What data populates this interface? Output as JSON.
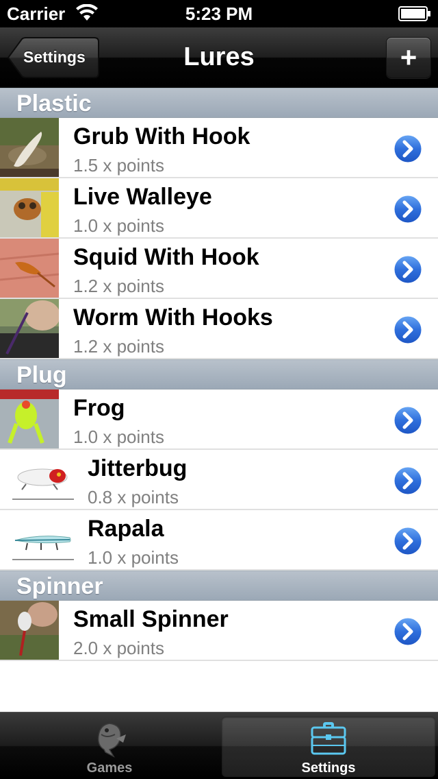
{
  "status_bar": {
    "carrier": "Carrier",
    "time": "5:23 PM"
  },
  "nav_bar": {
    "back_label": "Settings",
    "title": "Lures",
    "add_label": "+"
  },
  "sections": [
    {
      "title": "Plastic",
      "items": [
        {
          "name": "Grub With Hook",
          "points": "1.5 x points"
        },
        {
          "name": "Live Walleye",
          "points": "1.0 x points"
        },
        {
          "name": "Squid With Hook",
          "points": "1.2 x points"
        },
        {
          "name": "Worm With Hooks",
          "points": "1.2 x points"
        }
      ]
    },
    {
      "title": "Plug",
      "items": [
        {
          "name": "Frog",
          "points": "1.0 x points"
        },
        {
          "name": "Jitterbug",
          "points": "0.8 x points"
        },
        {
          "name": "Rapala",
          "points": "1.0 x points"
        }
      ]
    },
    {
      "title": "Spinner",
      "items": [
        {
          "name": "Small Spinner",
          "points": "2.0 x points"
        }
      ]
    }
  ],
  "tab_bar": {
    "tabs": [
      {
        "label": "Games",
        "icon": "fish-icon",
        "selected": false
      },
      {
        "label": "Settings",
        "icon": "tackle-box-icon",
        "selected": true
      }
    ]
  },
  "colors": {
    "disclosure_blue": "#2f6fdc",
    "section_header": "#a8b3bf",
    "selected_tab_icon": "#5bc8f0"
  }
}
